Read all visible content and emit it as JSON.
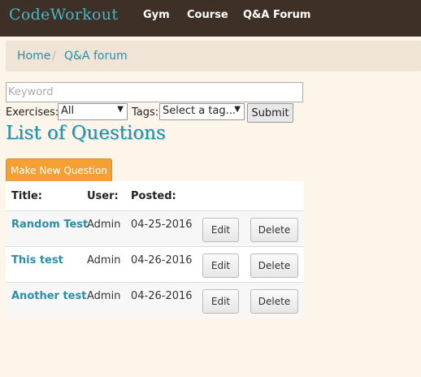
{
  "navbar": {
    "brand": "CodeWorkout",
    "links": [
      "Gym",
      "Course",
      "Q&A Forum"
    ]
  },
  "breadcrumb": {
    "items": [
      "Home",
      "Q&A forum"
    ],
    "separator": "/"
  },
  "search": {
    "placeholder": "Keyword",
    "exercises_label": "Exercises:",
    "exercises_value": "All",
    "tags_label": "Tags:",
    "tags_value": "Select a tag...",
    "submit_label": "Submit"
  },
  "page_title": "List of Questions",
  "new_question_label": "Make New Question",
  "table": {
    "headers": [
      "Title:",
      "User:",
      "Posted:"
    ],
    "rows": [
      {
        "title": "Random Test",
        "user": "Admin",
        "posted": "04-25-2016",
        "edit": "Edit",
        "delete": "Delete"
      },
      {
        "title": "This test",
        "user": "Admin",
        "posted": "04-26-2016",
        "edit": "Edit",
        "delete": "Delete"
      },
      {
        "title": "Another test",
        "user": "Admin",
        "posted": "04-26-2016",
        "edit": "Edit",
        "delete": "Delete"
      }
    ]
  },
  "colors": {
    "navbar_bg": "#3e2f27",
    "brand": "#4cb5c4",
    "link": "#2a8fa8",
    "page_bg": "#fdf4ea",
    "primary_button": "#f5a033"
  }
}
